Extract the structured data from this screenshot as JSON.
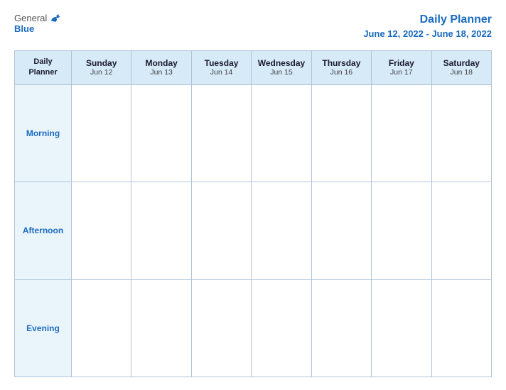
{
  "header": {
    "logo_general": "General",
    "logo_blue": "Blue",
    "title": "Daily Planner",
    "subtitle": "June 12, 2022 - June 18, 2022"
  },
  "calendar": {
    "row_header_label": "Daily\nPlanner",
    "columns": [
      {
        "day": "Sunday",
        "date": "Jun 12"
      },
      {
        "day": "Monday",
        "date": "Jun 13"
      },
      {
        "day": "Tuesday",
        "date": "Jun 14"
      },
      {
        "day": "Wednesday",
        "date": "Jun 15"
      },
      {
        "day": "Thursday",
        "date": "Jun 16"
      },
      {
        "day": "Friday",
        "date": "Jun 17"
      },
      {
        "day": "Saturday",
        "date": "Jun 18"
      }
    ],
    "rows": [
      {
        "label": "Morning"
      },
      {
        "label": "Afternoon"
      },
      {
        "label": "Evening"
      }
    ]
  }
}
